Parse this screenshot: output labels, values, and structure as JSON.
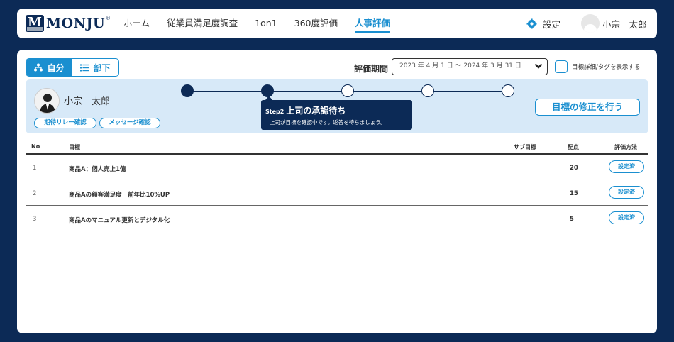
{
  "header": {
    "logo_text": "MONJU",
    "logo_letter": "M",
    "logo_reg": "®",
    "nav": [
      {
        "label": "ホーム"
      },
      {
        "label": "従業員満足度調査"
      },
      {
        "label": "1on1"
      },
      {
        "label": "360度評価"
      },
      {
        "label": "人事評価",
        "active": true
      }
    ],
    "settings_label": "設定",
    "user_name": "小宗　太郎"
  },
  "view_toggle": {
    "self_label": "自分",
    "subordinate_label": "部下",
    "selected": "自分"
  },
  "period": {
    "label": "評価期間",
    "value": "2023 年 4 月 1 日 〜 2024 年 3 月 31 日",
    "show_details_label": "目標詳細/タグを表示する"
  },
  "employee": {
    "name": "小宗　太郎",
    "relay_button": "期待リレー確認",
    "message_button": "メッセージ確認"
  },
  "progress": {
    "total_steps": 5,
    "current_step": 2,
    "tooltip_step": "Step2",
    "tooltip_title": "上司の承認待ち",
    "tooltip_desc": "上司が目標を確認中です。返答を待ちましょう。"
  },
  "edit_goals_button": "目標の修正を行う",
  "table": {
    "headers": {
      "no": "No",
      "goal": "目標",
      "sub_goal": "サブ目標",
      "score": "配点",
      "method": "評価方法"
    },
    "rows": [
      {
        "no": "1",
        "goal": "商品A：個人売上1億",
        "score": "20",
        "method": "設定済"
      },
      {
        "no": "2",
        "goal": "商品Aの顧客満足度　前年比10%UP",
        "score": "15",
        "method": "設定済"
      },
      {
        "no": "3",
        "goal": "商品Aのマニュアル更新とデジタル化",
        "score": "5",
        "method": "設定済"
      }
    ]
  },
  "colors": {
    "navy": "#0c2a56",
    "accent": "#1a8fd0",
    "band": "#d7e9f8"
  }
}
